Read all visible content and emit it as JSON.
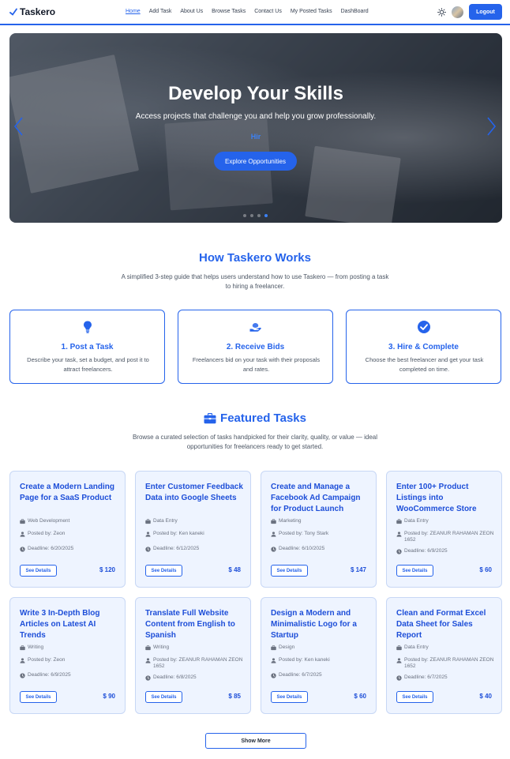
{
  "brand": {
    "name": "Taskero",
    "icon": "check-icon"
  },
  "nav": {
    "links": [
      "Home",
      "Add Task",
      "About Us",
      "Browse Tasks",
      "Contact Us",
      "My Posted Tasks",
      "DashBoard"
    ],
    "active": "Home",
    "logout_label": "Logout",
    "theme_icon": "sun-icon"
  },
  "hero": {
    "title": "Develop Your Skills",
    "subtitle": "Access projects that challenge you and help you grow professionally.",
    "typed_text": "Hir",
    "button_label": "Explore Opportunities",
    "slide_count": 4,
    "active_slide": 4
  },
  "how": {
    "title": "How Taskero Works",
    "description": "A simplified 3-step guide that helps users understand how to use Taskero — from posting a task to hiring a freelancer.",
    "steps": [
      {
        "icon": "lightbulb-icon",
        "title": "1. Post a Task",
        "desc": "Describe your task, set a budget, and post it to attract freelancers."
      },
      {
        "icon": "hand-money-icon",
        "title": "2. Receive Bids",
        "desc": "Freelancers bid on your task with their proposals and rates."
      },
      {
        "icon": "check-circle-icon",
        "title": "3. Hire & Complete",
        "desc": "Choose the best freelancer and get your task completed on time."
      }
    ]
  },
  "featured": {
    "title": "Featured Tasks",
    "icon": "briefcase-icon",
    "description": "Browse a curated selection of tasks handpicked for their clarity, quality, or value — ideal opportunities for freelancers ready to get started.",
    "see_details_label": "See Details",
    "show_more_label": "Show More",
    "tasks": [
      {
        "title": "Create a Modern Landing Page for a SaaS Product",
        "category": "Web Development",
        "posted_by": "Posted by: Zeon",
        "deadline": "Deadline: 6/20/2025",
        "price": "$ 120"
      },
      {
        "title": "Enter Customer Feedback Data into Google Sheets",
        "category": "Data Entry",
        "posted_by": "Posted by: Ken kaneki",
        "deadline": "Deadline: 6/12/2025",
        "price": "$ 48"
      },
      {
        "title": "Create and Manage a Facebook Ad Campaign for Product Launch",
        "category": "Marketing",
        "posted_by": "Posted by: Tony Stark",
        "deadline": "Deadline: 6/10/2025",
        "price": "$ 147"
      },
      {
        "title": "Enter 100+ Product Listings into WooCommerce Store",
        "category": "Data Entry",
        "posted_by": "Posted by: ZEANUR RAHAMAN ZEON 1652",
        "deadline": "Deadline: 6/9/2025",
        "price": "$ 60"
      },
      {
        "title": "Write 3 In-Depth Blog Articles on Latest AI Trends",
        "category": "Writing",
        "posted_by": "Posted by: Zeon",
        "deadline": "Deadline: 6/9/2025",
        "price": "$ 90"
      },
      {
        "title": "Translate Full Website Content from English to Spanish",
        "category": "Writing",
        "posted_by": "Posted by: ZEANUR RAHAMAN ZEON 1652",
        "deadline": "Deadline: 6/8/2025",
        "price": "$ 85"
      },
      {
        "title": "Design a Modern and Minimalistic Logo for a Startup",
        "category": "Design",
        "posted_by": "Posted by: Ken kaneki",
        "deadline": "Deadline: 6/7/2025",
        "price": "$ 60"
      },
      {
        "title": "Clean and Format Excel Data Sheet for Sales Report",
        "category": "Data Entry",
        "posted_by": "Posted by: ZEANUR RAHAMAN ZEON 1652",
        "deadline": "Deadline: 6/7/2025",
        "price": "$ 40"
      }
    ]
  },
  "colors": {
    "accent": "#2563eb",
    "card_bg": "#eef4ff"
  }
}
